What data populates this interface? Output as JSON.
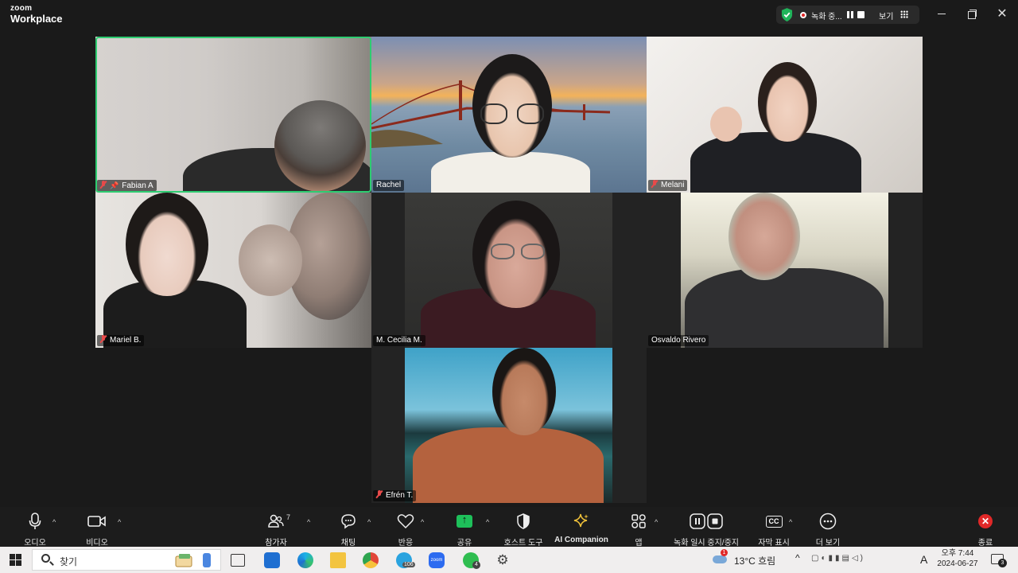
{
  "app": {
    "logo_line1": "zoom",
    "logo_line2": "Workplace"
  },
  "recording": {
    "status": "녹화 중...",
    "view_label": "보기"
  },
  "window_controls": {
    "close_glyph": "✕"
  },
  "participants": [
    {
      "name": "Fabian A",
      "muted": true,
      "pinned": true,
      "active_speaker": true
    },
    {
      "name": "Rachel",
      "muted": false
    },
    {
      "name": "Melani",
      "muted": true
    },
    {
      "name": "Mariel B.",
      "muted": true
    },
    {
      "name": "M. Cecilia M.",
      "muted": false
    },
    {
      "name": "Osvaldo Rivero",
      "muted": false
    },
    {
      "name": "Efrén T.",
      "muted": true
    }
  ],
  "toolbar": {
    "audio": "오디오",
    "video": "비디오",
    "participants": "참가자",
    "participants_count": "7",
    "chat": "채팅",
    "reactions": "반응",
    "share": "공유",
    "host_tools": "호스트 도구",
    "ai_companion": "AI Companion",
    "apps": "앱",
    "recording": "녹화 일시 중지/중지",
    "captions": "자막 표시",
    "captions_icon": "CC",
    "more": "더 보기",
    "end": "종료"
  },
  "taskbar": {
    "search_placeholder": "찾기",
    "weather": "13°C 흐림",
    "time": "오후 7:44",
    "date": "2024-06-27",
    "ime": "A",
    "notification_count": "3",
    "telegram_badge": "106",
    "whatsapp_badge": "4",
    "weather_alert": "1",
    "zoom_icon_text": "zoom"
  },
  "colors": {
    "active_speaker_border": "#2ecc71",
    "share_green": "#1ec05a",
    "end_red": "#e02828",
    "muted_red": "#e84a4a"
  }
}
